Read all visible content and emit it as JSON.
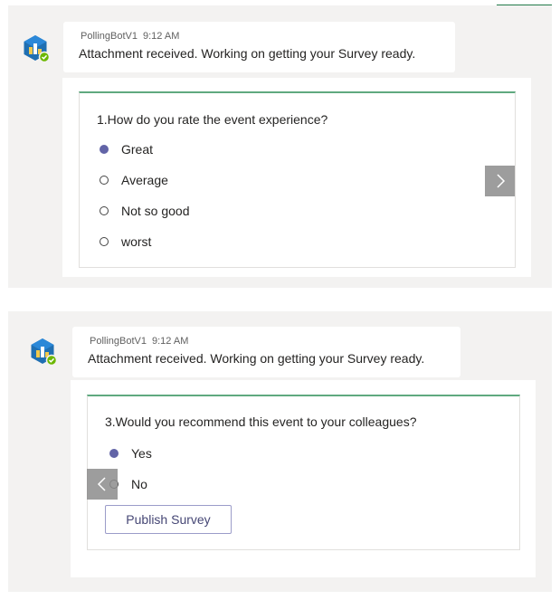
{
  "screenshots": [
    {
      "message": {
        "sender": "PollingBotV1",
        "time": "9:12 AM",
        "text": "Attachment received. Working on getting your Survey ready."
      },
      "question": "1.How do you rate the event experience?",
      "options": [
        "Great",
        "Average",
        "Not so good",
        "worst"
      ],
      "selected_option": "Great",
      "nav_button": "next-arrow-icon"
    },
    {
      "message": {
        "sender": "PollingBotV1",
        "time": "9:12 AM",
        "text": "Attachment received. Working on getting your Survey ready."
      },
      "question": "3.Would you recommend this event to your colleagues?",
      "options": [
        "Yes",
        "No"
      ],
      "selected_option": "Yes",
      "nav_button": "previous-arrow-icon",
      "publish_label": "Publish Survey"
    }
  ],
  "colors": {
    "accent_green": "#237b4b",
    "card_top_border": "#5fa97f",
    "selected_radio": "#6264a7",
    "button_text": "#464775",
    "nav_button_bg": "#8c8c8c"
  }
}
